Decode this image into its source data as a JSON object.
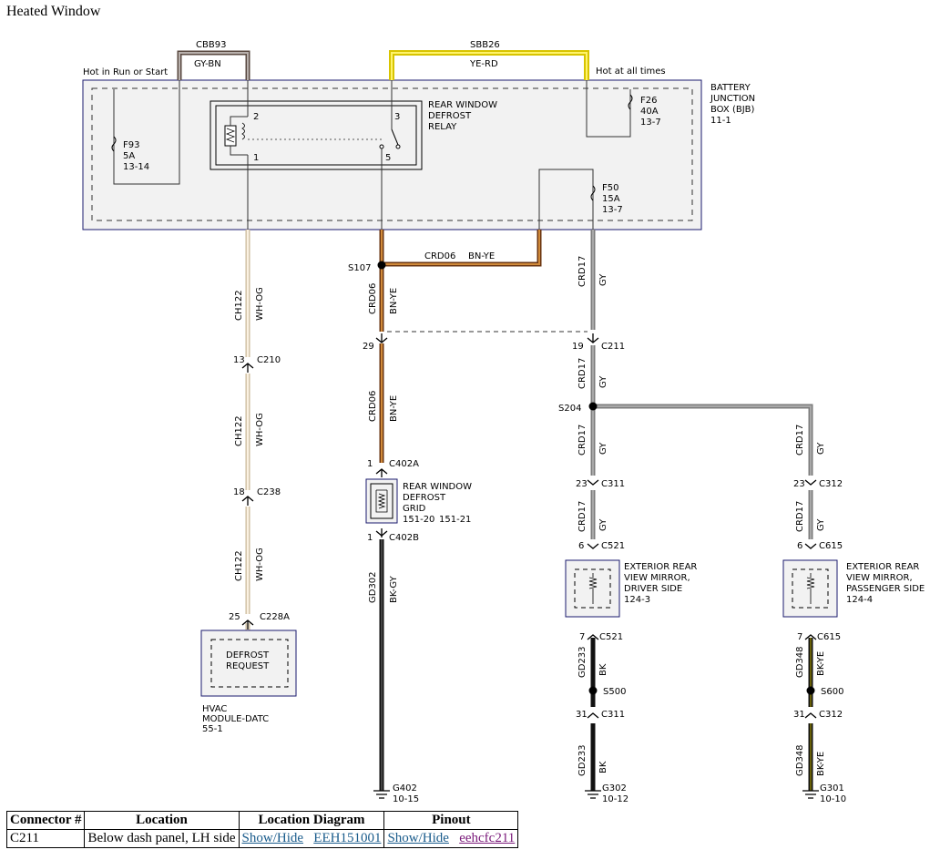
{
  "page_title": "Heated Window",
  "colors": {
    "bjb_fill": "#f2f2f2",
    "box_border": "#1a1a6e",
    "wire_gy": "#8c8c8c",
    "wire_gy_bn": "#8a7060",
    "wire_ye_rd": "#f0e000",
    "wire_bn_ye": "#a0521e",
    "wire_wh_og": "#f0e0c0",
    "wire_bk": "#111111",
    "link": "#1a5c8c",
    "link_visited": "#7a1a7a"
  },
  "labels": {
    "cbb93": "CBB93",
    "gy_bn": "GY-BN",
    "sbb26": "SBB26",
    "ye_rd": "YE-RD",
    "hot_run_start": "Hot in Run or Start",
    "hot_all_times": "Hot at all times",
    "bjb_1": "BATTERY",
    "bjb_2": "JUNCTION",
    "bjb_3": "BOX (BJB)",
    "bjb_4": "11-1",
    "f26_1": "F26",
    "f26_2": "40A",
    "f26_3": "13-7",
    "f93_1": "F93",
    "f93_2": "5A",
    "f93_3": "13-14",
    "f50_1": "F50",
    "f50_2": "15A",
    "f50_3": "13-7",
    "relay_1": "REAR WINDOW",
    "relay_2": "DEFROST",
    "relay_3": "RELAY",
    "pin2": "2",
    "pin3": "3",
    "pin1": "1",
    "pin5": "5",
    "crd06": "CRD06",
    "bn_ye": "BN-YE",
    "s107": "S107",
    "crd17": "CRD17",
    "gy": "GY",
    "ch122": "CH122",
    "wh_og": "WH-OG",
    "n29": "29",
    "n19": "19",
    "c211": "C211",
    "n13": "13",
    "c210": "C210",
    "s204": "S204",
    "n18": "18",
    "c238": "C238",
    "n1a": "1",
    "c402a": "C402A",
    "grid_1": "REAR WINDOW",
    "grid_2": "DEFROST",
    "grid_3": "GRID",
    "grid_4": "151-20",
    "grid_5": "151-21",
    "n1b": "1",
    "c402b": "C402B",
    "n23a": "23",
    "c311": "C311",
    "n23b": "23",
    "c312": "C312",
    "n6a": "6",
    "c521": "C521",
    "n6b": "6",
    "c615": "C615",
    "mirr_d1": "EXTERIOR REAR",
    "mirr_d2": "VIEW MIRROR,",
    "mirr_d3": "DRIVER SIDE",
    "mirr_d4": "124-3",
    "mirr_p1": "EXTERIOR REAR",
    "mirr_p2": "VIEW MIRROR,",
    "mirr_p3": "PASSENGER SIDE",
    "mirr_p4": "124-4",
    "gd302": "GD302",
    "bk_gy": "BK-GY",
    "n25": "25",
    "c228a": "C228A",
    "defrost_req_1": "DEFROST",
    "defrost_req_2": "REQUEST",
    "hvac_1": "HVAC",
    "hvac_2": "MODULE-DATC",
    "hvac_3": "55-1",
    "n7a": "7",
    "c521b": "C521",
    "n7b": "7",
    "c615b": "C615",
    "gd233": "GD233",
    "bk": "BK",
    "gd348": "GD348",
    "bk_ye": "BK-YE",
    "s500": "S500",
    "s600": "S600",
    "n31a": "31",
    "c311b": "C311",
    "n31b": "31",
    "c312b": "C312",
    "gd233b": "GD233",
    "bkb": "BK",
    "gd348b": "GD348",
    "bk_yeb": "BK-YE",
    "g402": "G402",
    "g402_ref": "10-15",
    "g302": "G302",
    "g302_ref": "10-12",
    "g301": "G301",
    "g301_ref": "10-10"
  },
  "table": {
    "headers": [
      "Connector #",
      "Location",
      "Location Diagram",
      "Pinout"
    ],
    "rows": [
      {
        "connector": "C211",
        "location": "Below dash panel, LH side",
        "show_hide_1": "Show/Hide",
        "diagram_ref": "EEH151001",
        "show_hide_2": "Show/Hide",
        "pinout_ref": "eehcfc211"
      }
    ]
  }
}
